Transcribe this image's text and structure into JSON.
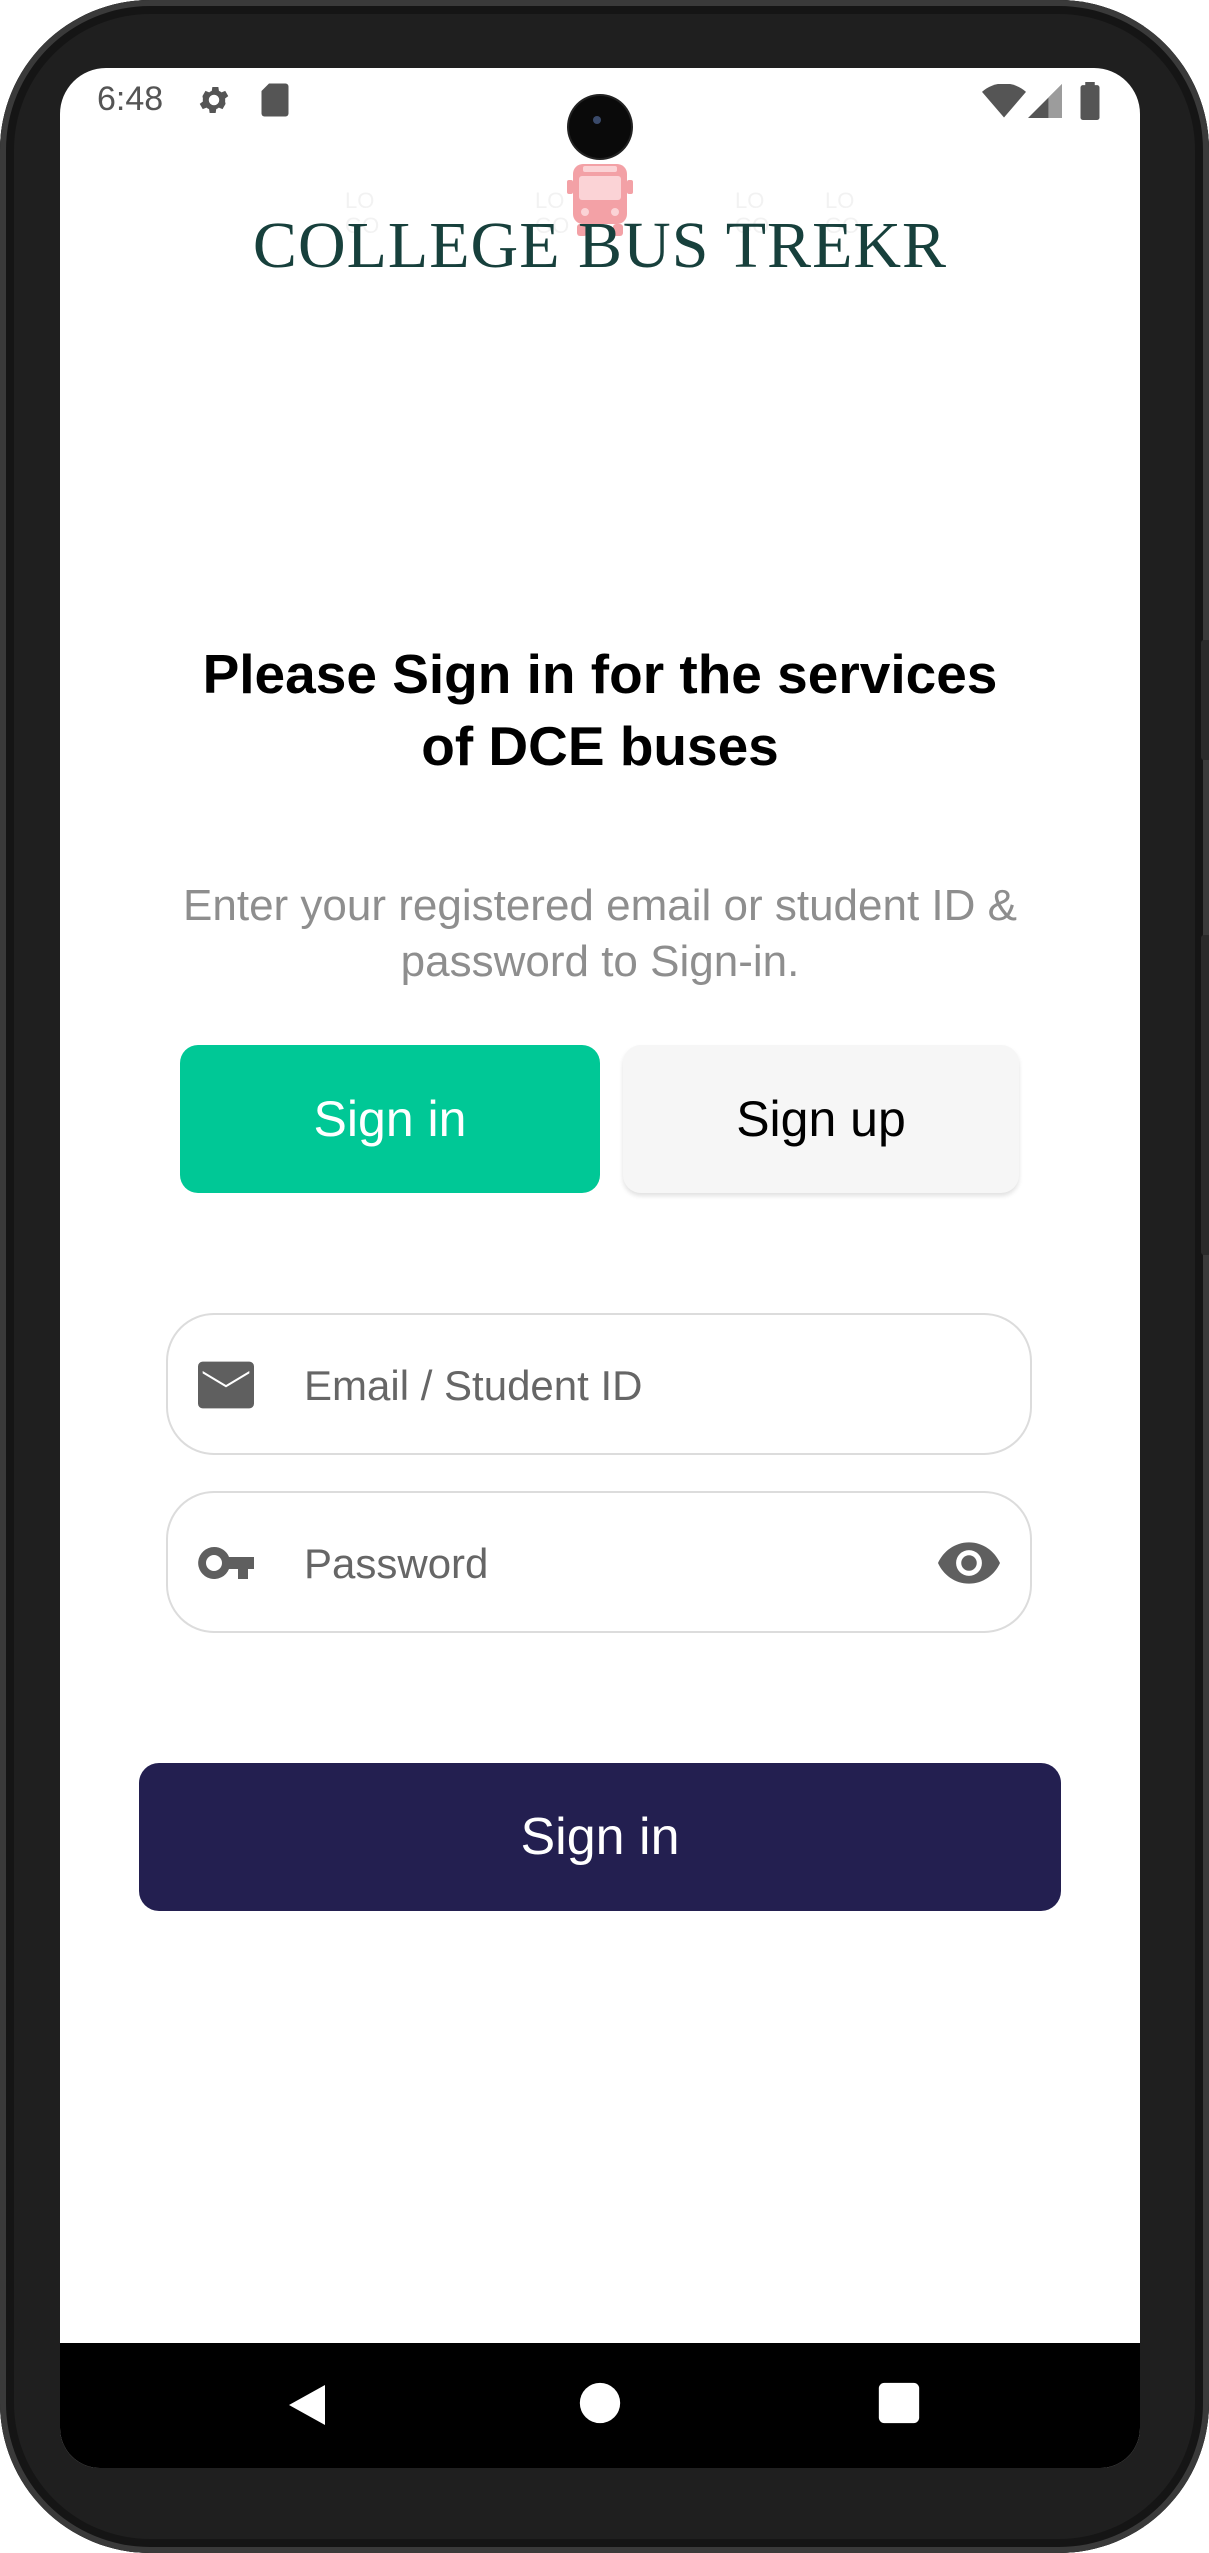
{
  "status_bar": {
    "time": "6:48",
    "left_icons": [
      "gear-icon",
      "sd-card-icon"
    ],
    "right_icons": [
      "wifi-icon",
      "signal-icon",
      "battery-icon"
    ]
  },
  "logo": {
    "text": "COLLEGE BUS TREKR",
    "icon": "bus-icon",
    "colors": {
      "text": "#17403c",
      "bus": "#f3a1a6",
      "lines": "#a9d8d4"
    }
  },
  "heading": "Please Sign in for the services of DCE buses",
  "subtext": "Enter your registered email or student ID & password to Sign-in.",
  "tabs": [
    {
      "label": "Sign in",
      "active": true
    },
    {
      "label": "Sign up",
      "active": false
    }
  ],
  "form": {
    "email": {
      "placeholder": "Email / Student ID",
      "value": "",
      "icon": "mail-icon"
    },
    "password": {
      "placeholder": "Password",
      "value": "",
      "icon": "key-icon",
      "toggle_icon": "eye-icon"
    }
  },
  "submit_button": {
    "label": "Sign in"
  },
  "nav_bar": [
    "back-icon",
    "home-icon",
    "recents-icon"
  ],
  "colors": {
    "accent": "#00c896",
    "primary": "#231f50",
    "heading": "#000000",
    "muted": "#8e8e8e"
  }
}
